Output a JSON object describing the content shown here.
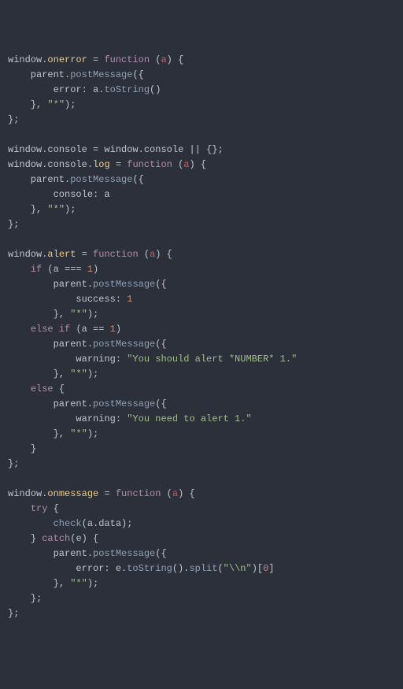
{
  "code": [
    [
      [
        "default",
        "window"
      ],
      [
        "punct",
        "."
      ],
      [
        "obj",
        "onerror"
      ],
      [
        "default",
        " "
      ],
      [
        "operator",
        "="
      ],
      [
        "default",
        " "
      ],
      [
        "keyword",
        "function"
      ],
      [
        "default",
        " "
      ],
      [
        "punct",
        "("
      ],
      [
        "param",
        "a"
      ],
      [
        "punct",
        ")"
      ],
      [
        "default",
        " "
      ],
      [
        "punct",
        "{"
      ]
    ],
    [
      [
        "default",
        "    parent"
      ],
      [
        "punct",
        "."
      ],
      [
        "method",
        "postMessage"
      ],
      [
        "punct",
        "("
      ],
      [
        "punct",
        "{"
      ]
    ],
    [
      [
        "default",
        "        error"
      ],
      [
        "operator",
        ":"
      ],
      [
        "default",
        " a"
      ],
      [
        "punct",
        "."
      ],
      [
        "method",
        "toString"
      ],
      [
        "punct",
        "("
      ],
      [
        "punct",
        ")"
      ]
    ],
    [
      [
        "default",
        "    "
      ],
      [
        "punct",
        "}"
      ],
      [
        "punct",
        ","
      ],
      [
        "default",
        " "
      ],
      [
        "string",
        "\"*\""
      ],
      [
        "punct",
        ")"
      ],
      [
        "punct",
        ";"
      ]
    ],
    [
      [
        "punct",
        "}"
      ],
      [
        "punct",
        ";"
      ]
    ],
    [],
    [
      [
        "default",
        "window"
      ],
      [
        "punct",
        "."
      ],
      [
        "default",
        "console "
      ],
      [
        "operator",
        "="
      ],
      [
        "default",
        " window"
      ],
      [
        "punct",
        "."
      ],
      [
        "default",
        "console "
      ],
      [
        "operator",
        "||"
      ],
      [
        "default",
        " "
      ],
      [
        "punct",
        "{"
      ],
      [
        "punct",
        "}"
      ],
      [
        "punct",
        ";"
      ]
    ],
    [
      [
        "default",
        "window"
      ],
      [
        "punct",
        "."
      ],
      [
        "default",
        "console"
      ],
      [
        "punct",
        "."
      ],
      [
        "obj",
        "log"
      ],
      [
        "default",
        " "
      ],
      [
        "operator",
        "="
      ],
      [
        "default",
        " "
      ],
      [
        "keyword",
        "function"
      ],
      [
        "default",
        " "
      ],
      [
        "punct",
        "("
      ],
      [
        "param",
        "a"
      ],
      [
        "punct",
        ")"
      ],
      [
        "default",
        " "
      ],
      [
        "punct",
        "{"
      ]
    ],
    [
      [
        "default",
        "    parent"
      ],
      [
        "punct",
        "."
      ],
      [
        "method",
        "postMessage"
      ],
      [
        "punct",
        "("
      ],
      [
        "punct",
        "{"
      ]
    ],
    [
      [
        "default",
        "        console"
      ],
      [
        "operator",
        ":"
      ],
      [
        "default",
        " a"
      ]
    ],
    [
      [
        "default",
        "    "
      ],
      [
        "punct",
        "}"
      ],
      [
        "punct",
        ","
      ],
      [
        "default",
        " "
      ],
      [
        "string",
        "\"*\""
      ],
      [
        "punct",
        ")"
      ],
      [
        "punct",
        ";"
      ]
    ],
    [
      [
        "punct",
        "}"
      ],
      [
        "punct",
        ";"
      ]
    ],
    [],
    [
      [
        "default",
        "window"
      ],
      [
        "punct",
        "."
      ],
      [
        "obj",
        "alert"
      ],
      [
        "default",
        " "
      ],
      [
        "operator",
        "="
      ],
      [
        "default",
        " "
      ],
      [
        "keyword",
        "function"
      ],
      [
        "default",
        " "
      ],
      [
        "punct",
        "("
      ],
      [
        "param",
        "a"
      ],
      [
        "punct",
        ")"
      ],
      [
        "default",
        " "
      ],
      [
        "punct",
        "{"
      ]
    ],
    [
      [
        "default",
        "    "
      ],
      [
        "keyword",
        "if"
      ],
      [
        "default",
        " "
      ],
      [
        "punct",
        "("
      ],
      [
        "default",
        "a "
      ],
      [
        "operator",
        "==="
      ],
      [
        "default",
        " "
      ],
      [
        "number",
        "1"
      ],
      [
        "punct",
        ")"
      ]
    ],
    [
      [
        "default",
        "        parent"
      ],
      [
        "punct",
        "."
      ],
      [
        "method",
        "postMessage"
      ],
      [
        "punct",
        "("
      ],
      [
        "punct",
        "{"
      ]
    ],
    [
      [
        "default",
        "            success"
      ],
      [
        "operator",
        ":"
      ],
      [
        "default",
        " "
      ],
      [
        "number",
        "1"
      ]
    ],
    [
      [
        "default",
        "        "
      ],
      [
        "punct",
        "}"
      ],
      [
        "punct",
        ","
      ],
      [
        "default",
        " "
      ],
      [
        "string",
        "\"*\""
      ],
      [
        "punct",
        ")"
      ],
      [
        "punct",
        ";"
      ]
    ],
    [
      [
        "default",
        "    "
      ],
      [
        "keyword",
        "else if"
      ],
      [
        "default",
        " "
      ],
      [
        "punct",
        "("
      ],
      [
        "default",
        "a "
      ],
      [
        "operator",
        "=="
      ],
      [
        "default",
        " "
      ],
      [
        "number",
        "1"
      ],
      [
        "punct",
        ")"
      ]
    ],
    [
      [
        "default",
        "        parent"
      ],
      [
        "punct",
        "."
      ],
      [
        "method",
        "postMessage"
      ],
      [
        "punct",
        "("
      ],
      [
        "punct",
        "{"
      ]
    ],
    [
      [
        "default",
        "            warning"
      ],
      [
        "operator",
        ":"
      ],
      [
        "default",
        " "
      ],
      [
        "string",
        "\"You should alert *NUMBER* 1.\""
      ]
    ],
    [
      [
        "default",
        "        "
      ],
      [
        "punct",
        "}"
      ],
      [
        "punct",
        ","
      ],
      [
        "default",
        " "
      ],
      [
        "string",
        "\"*\""
      ],
      [
        "punct",
        ")"
      ],
      [
        "punct",
        ";"
      ]
    ],
    [
      [
        "default",
        "    "
      ],
      [
        "keyword",
        "else"
      ],
      [
        "default",
        " "
      ],
      [
        "punct",
        "{"
      ]
    ],
    [
      [
        "default",
        "        parent"
      ],
      [
        "punct",
        "."
      ],
      [
        "method",
        "postMessage"
      ],
      [
        "punct",
        "("
      ],
      [
        "punct",
        "{"
      ]
    ],
    [
      [
        "default",
        "            warning"
      ],
      [
        "operator",
        ":"
      ],
      [
        "default",
        " "
      ],
      [
        "string",
        "\"You need to alert 1.\""
      ]
    ],
    [
      [
        "default",
        "        "
      ],
      [
        "punct",
        "}"
      ],
      [
        "punct",
        ","
      ],
      [
        "default",
        " "
      ],
      [
        "string",
        "\"*\""
      ],
      [
        "punct",
        ")"
      ],
      [
        "punct",
        ";"
      ]
    ],
    [
      [
        "default",
        "    "
      ],
      [
        "punct",
        "}"
      ]
    ],
    [
      [
        "punct",
        "}"
      ],
      [
        "punct",
        ";"
      ]
    ],
    [],
    [
      [
        "default",
        "window"
      ],
      [
        "punct",
        "."
      ],
      [
        "obj",
        "onmessage"
      ],
      [
        "default",
        " "
      ],
      [
        "operator",
        "="
      ],
      [
        "default",
        " "
      ],
      [
        "keyword",
        "function"
      ],
      [
        "default",
        " "
      ],
      [
        "punct",
        "("
      ],
      [
        "param",
        "a"
      ],
      [
        "punct",
        ")"
      ],
      [
        "default",
        " "
      ],
      [
        "punct",
        "{"
      ]
    ],
    [
      [
        "default",
        "    "
      ],
      [
        "keyword",
        "try"
      ],
      [
        "default",
        " "
      ],
      [
        "punct",
        "{"
      ]
    ],
    [
      [
        "default",
        "        "
      ],
      [
        "method",
        "check"
      ],
      [
        "punct",
        "("
      ],
      [
        "default",
        "a"
      ],
      [
        "punct",
        "."
      ],
      [
        "default",
        "data"
      ],
      [
        "punct",
        ")"
      ],
      [
        "punct",
        ";"
      ]
    ],
    [
      [
        "default",
        "    "
      ],
      [
        "punct",
        "}"
      ],
      [
        "default",
        " "
      ],
      [
        "keyword",
        "catch"
      ],
      [
        "punct",
        "("
      ],
      [
        "default",
        "e"
      ],
      [
        "punct",
        ")"
      ],
      [
        "default",
        " "
      ],
      [
        "punct",
        "{"
      ]
    ],
    [
      [
        "default",
        "        parent"
      ],
      [
        "punct",
        "."
      ],
      [
        "method",
        "postMessage"
      ],
      [
        "punct",
        "("
      ],
      [
        "punct",
        "{"
      ]
    ],
    [
      [
        "default",
        "            error"
      ],
      [
        "operator",
        ":"
      ],
      [
        "default",
        " e"
      ],
      [
        "punct",
        "."
      ],
      [
        "method",
        "toString"
      ],
      [
        "punct",
        "("
      ],
      [
        "punct",
        ")"
      ],
      [
        "punct",
        "."
      ],
      [
        "method",
        "split"
      ],
      [
        "punct",
        "("
      ],
      [
        "string",
        "\"\\\\n\""
      ],
      [
        "punct",
        ")"
      ],
      [
        "punct",
        "["
      ],
      [
        "number",
        "0"
      ],
      [
        "punct",
        "]"
      ]
    ],
    [
      [
        "default",
        "        "
      ],
      [
        "punct",
        "}"
      ],
      [
        "punct",
        ","
      ],
      [
        "default",
        " "
      ],
      [
        "string",
        "\"*\""
      ],
      [
        "punct",
        ")"
      ],
      [
        "punct",
        ";"
      ]
    ],
    [
      [
        "default",
        "    "
      ],
      [
        "punct",
        "}"
      ],
      [
        "punct",
        ";"
      ]
    ],
    [
      [
        "punct",
        "}"
      ],
      [
        "punct",
        ";"
      ]
    ]
  ]
}
